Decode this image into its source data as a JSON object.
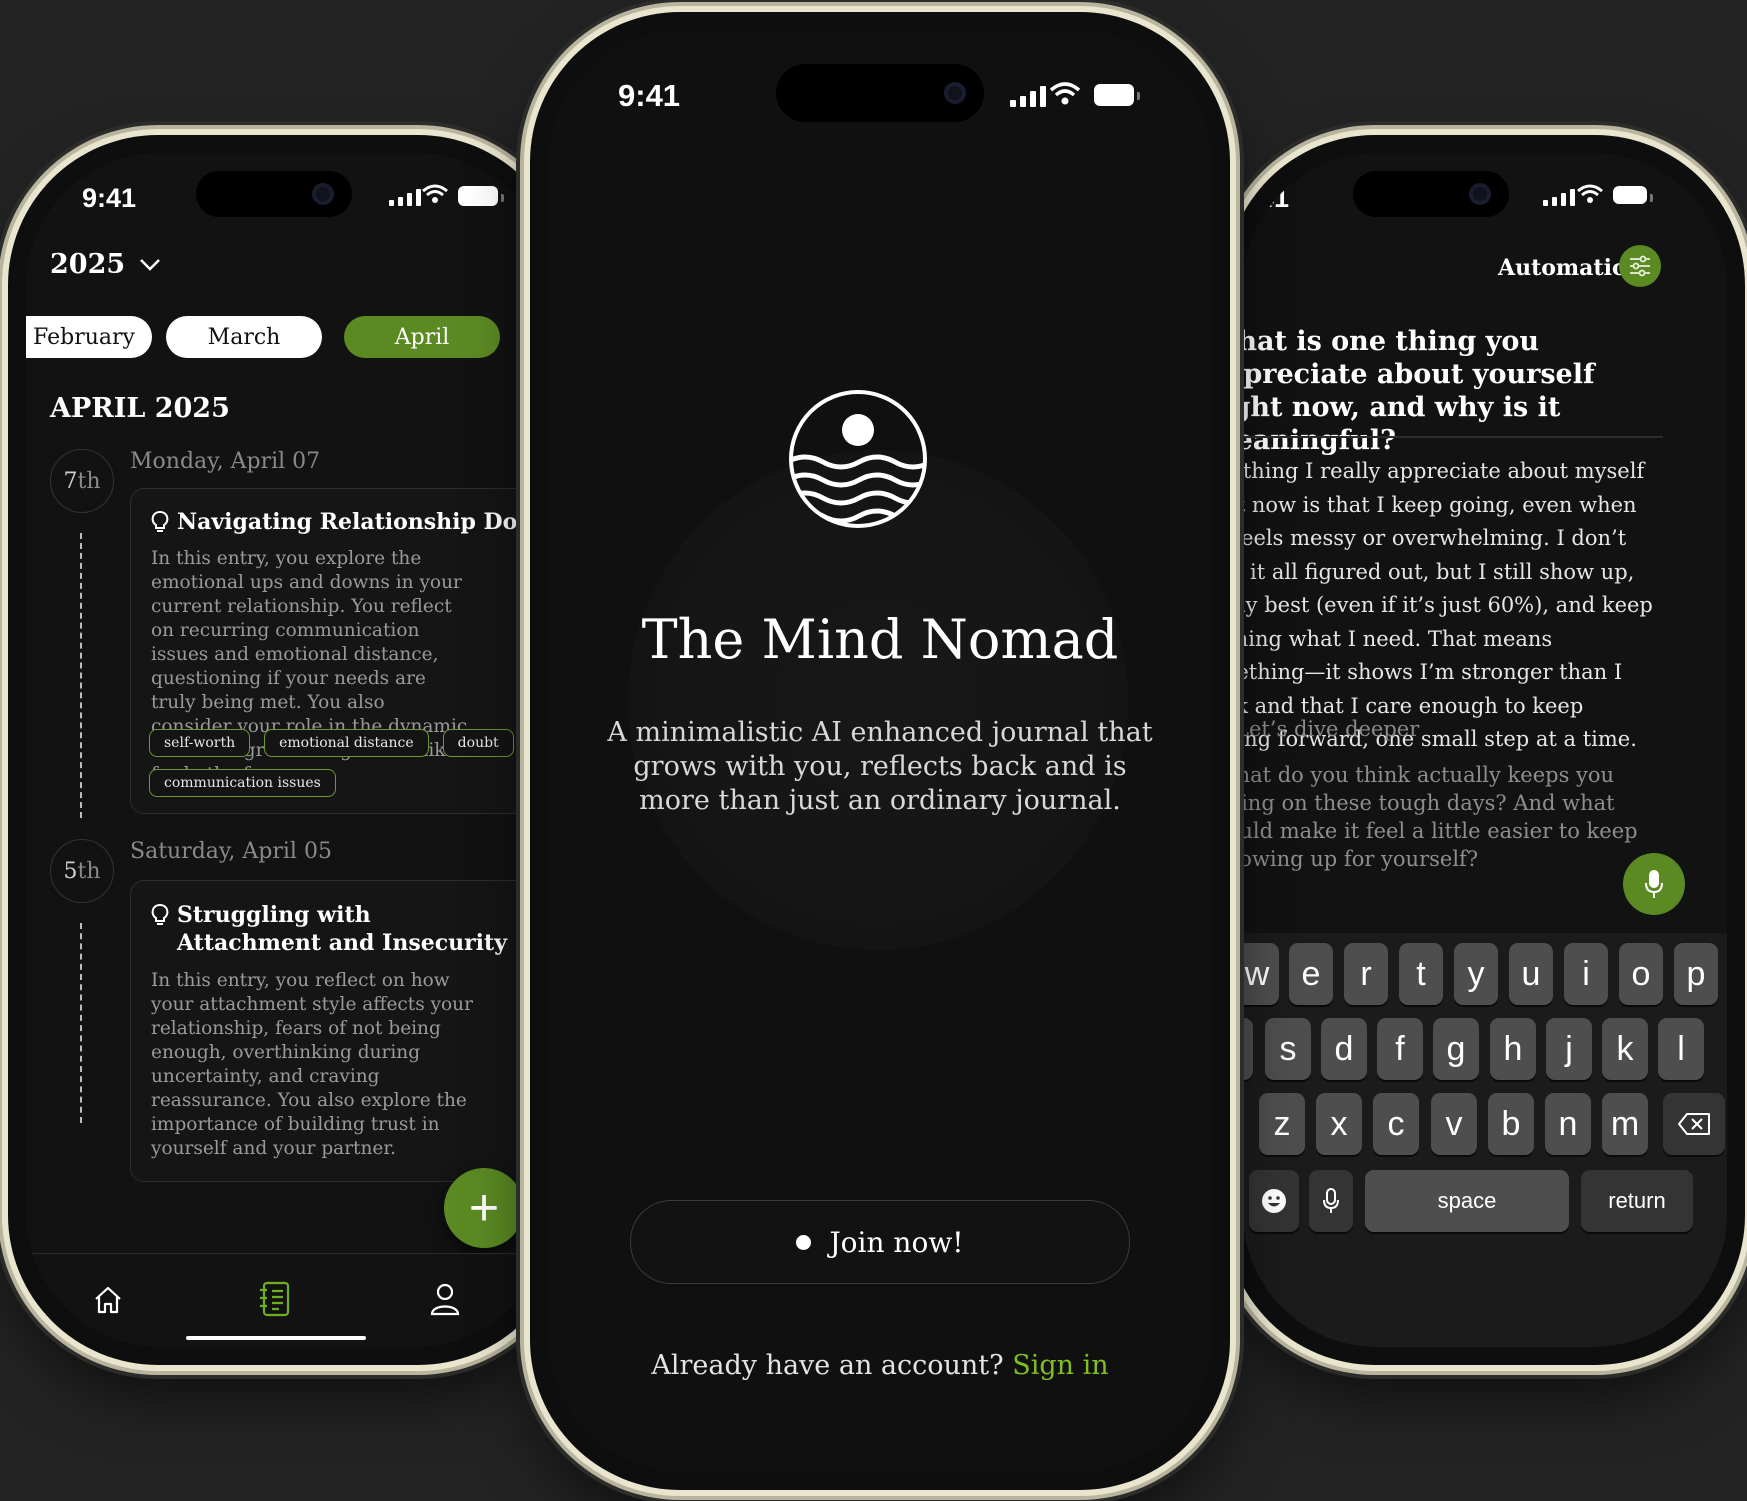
{
  "status_bar": {
    "time": "9:41"
  },
  "left_screen": {
    "year": "2025",
    "months": [
      "February",
      "March",
      "April"
    ],
    "selected_month": "April",
    "section_title": "APRIL 2025",
    "entries": [
      {
        "day_num": "7",
        "day_suffix": "th",
        "date": "Monday, April 07",
        "title": "Navigating Relationship Doubts",
        "summary": "In this entry, you explore the emotional ups and downs in your current relationship. You reflect on recurring communication issues and emotional distance, questioning if your needs are truly being met. You also consider your role in the dynamic and what growth might look like for both of you.",
        "tags": [
          "self-worth",
          "emotional distance",
          "doubt",
          "communication issues"
        ]
      },
      {
        "day_num": "5",
        "day_suffix": "th",
        "date": "Saturday, April 05",
        "title": "Struggling with Attachment and Insecurity",
        "summary": "In this entry, you reflect on how your attachment style affects your relationship, fears of not being enough, overthinking during uncertainty, and craving reassurance. You also explore the importance of building trust in yourself and your partner."
      }
    ],
    "fab_label": "+",
    "nav": [
      "home-icon",
      "journal-icon",
      "profile-icon"
    ]
  },
  "middle_screen": {
    "app_name": "The Mind Nomad",
    "tagline": "A minimalistic AI enhanced journal that grows with you, reflects back and is more than just an ordinary journal.",
    "cta_label": "Join now!",
    "account_prompt": "Already have an account?",
    "sign_in_label": "Sign in"
  },
  "right_screen": {
    "mode_label": "Automatic",
    "question": "What is one thing you appreciate about yourself right now, and why is it meaningful?",
    "answer": "One thing I really appreciate about myself right now is that I keep going, even when life feels messy or overwhelming. I don’t have it all figured out, but I still show up, do my best (even if it’s just 60%), and keep learning what I need. That means something—it shows I’m stronger than I think and that I care enough to keep moving forward, one small step at a time.",
    "followup_label": "Let’s dive deeper",
    "followup_question": "What do you think actually keeps you going on these tough days? And what could make it feel a little easier to keep showing up for yourself?",
    "keyboard": {
      "row1": [
        "w",
        "e",
        "r",
        "t",
        "y",
        "u",
        "i",
        "o",
        "p"
      ],
      "row2": [
        "s",
        "d",
        "f",
        "g",
        "h",
        "j",
        "k",
        "l"
      ],
      "row3": [
        "z",
        "x",
        "c",
        "v",
        "b",
        "n",
        "m"
      ],
      "space_label": "space",
      "return_label": "return"
    }
  },
  "colors": {
    "accent": "#5b8a23",
    "sign_in": "#7fbf1e",
    "background": "#232323",
    "frame": "#e9e5cf"
  }
}
